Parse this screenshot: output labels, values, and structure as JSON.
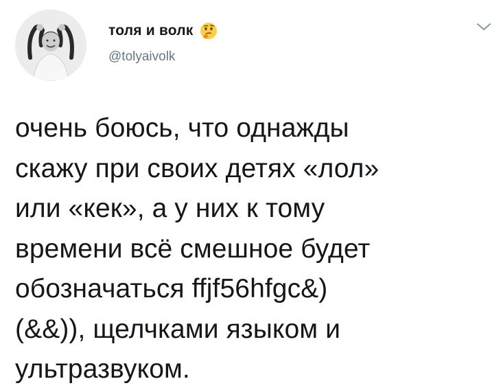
{
  "tweet": {
    "author": {
      "display_name": "толя и волк",
      "handle": "@tolyaivolk",
      "avatar_icon": "person-photo-avatar",
      "emoji_icon": "thinking-face-emoji"
    },
    "menu_icon": "chevron-down-icon",
    "text_lines": [
      "очень боюсь, что однажды",
      "скажу при своих детях «лол»",
      "или «кек», а у них к тому",
      "времени всё смешное будет",
      "обозначаться ffjf56hfgc&)",
      "(&&)), щелчками языком и",
      "ультразвуком."
    ]
  },
  "colors": {
    "text": "#14171a",
    "secondary_text": "#657786",
    "background": "#ffffff"
  }
}
